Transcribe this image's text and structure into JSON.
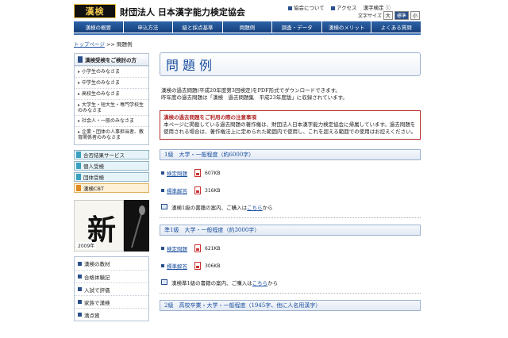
{
  "header": {
    "logo": "漢検",
    "org_name": "財団法人 日本漢字能力検定協会",
    "links": [
      "協会について",
      "アクセス",
      "漢字検定 ⓘ"
    ],
    "font_size_label": "文字サイズ",
    "font_sizes": [
      "大",
      "標準",
      "小"
    ]
  },
  "nav": [
    "漢検の概要",
    "申込方法",
    "級と採点基準",
    "問題例",
    "調査・データ",
    "漢検のメリット",
    "よくある質問"
  ],
  "breadcrumb": {
    "home": "トップページ",
    "sep": ">>",
    "current": "問題例"
  },
  "sidebar": {
    "heading": "漢検受検をご検討の方",
    "items": [
      "小学生のみなさま",
      "中学生のみなさま",
      "高校生のみなさま",
      "大学生・短大生・専門学校生のみなさま",
      "社会人・一般のみなさま",
      "企業・団体の人事担当者、教育関係者のみなさま"
    ],
    "buttons": [
      "合否結果サービス",
      "個人受検",
      "団体受検",
      "漢検CBT"
    ],
    "button_colors": [
      "#e6f4fa",
      "#e6f4fa",
      "#e6f4fa",
      "#fdf0d5"
    ],
    "photo_year": "2009年",
    "photo_kanji": "新",
    "items2": [
      "漢検の教材",
      "合格体験記",
      "入試で評価",
      "家族で漢検",
      "満点賞"
    ]
  },
  "main": {
    "title": "問題例",
    "intro": [
      "漢検の過去問題(平成20年度第3回検定)をPDF形式でダウンロードできます。",
      "昨年度の過去問題は「漢検　過去問題集　平成23年度版」に収録されています。"
    ],
    "notice_head": "漢検の過去問題をご利用の際の注意事項",
    "notice_body": "本ページに掲載している過去問題の著作権は、財団法人日本漢字能力検定協会に帰属しています。過去問題を使用される場合は、著作権法上に定められた範囲内で使用し、これを超える範囲での使用はお控えください。",
    "sections": [
      {
        "head": "1級　大学・一般程度（約6000字）",
        "rows": [
          {
            "label": "検定問題",
            "size": "607KB"
          },
          {
            "label": "標準解答",
            "size": "316KB"
          }
        ],
        "book_text": "漢検1級の書籍の案内、ご購入は",
        "book_link": "こちら",
        "book_after": "から"
      },
      {
        "head": "準1級　大学・一般程度（約3000字）",
        "rows": [
          {
            "label": "検定問題",
            "size": "621KB"
          },
          {
            "label": "標準解答",
            "size": "306KB"
          }
        ],
        "book_text": "漢検準1級の書籍の案内、ご購入は",
        "book_link": "こちら",
        "book_after": "から"
      },
      {
        "head": "2級　高校卒業・大学・一般程度（1945字、他に人名用漢字）"
      }
    ]
  }
}
